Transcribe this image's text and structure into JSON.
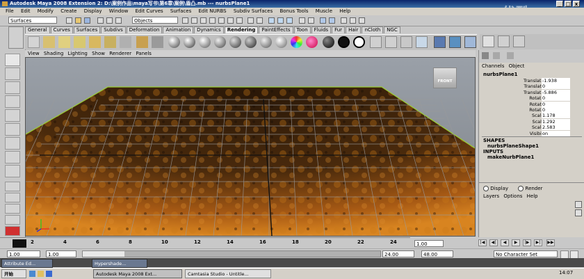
{
  "window": {
    "title": "Autodesk Maya 2008 Extension 2: D:\\案例作品\\maya写书\\第6章\\案例\\盾凸.mb  ---  nurbsPlane1",
    "min": "_",
    "max": "□",
    "close": "x"
  },
  "watermark": "优酷",
  "menu": [
    "File",
    "Edit",
    "Modify",
    "Create",
    "Display",
    "Window",
    "Edit Curves",
    "Surfaces",
    "Edit NURBS",
    "Subdiv Surfaces",
    "Bonus Tools",
    "Muscle",
    "Help"
  ],
  "status_line": {
    "menu_set": "Surfaces",
    "selection_mode": "Objects"
  },
  "shelf_tabs": [
    "General",
    "Curves",
    "Surfaces",
    "Subdivs",
    "Deformation",
    "Animation",
    "Dynamics",
    "Rendering",
    "PaintEffects",
    "Toon",
    "Fluids",
    "Fur",
    "Hair",
    "nCloth",
    "NGC"
  ],
  "active_shelf_tab": "Rendering",
  "panel_menu": [
    "View",
    "Shading",
    "Lighting",
    "Show",
    "Renderer",
    "Panels"
  ],
  "view_cube": "FRONT",
  "channel_box": {
    "tabs": [
      "Channels",
      "Object"
    ],
    "object_name": "nurbsPlane1",
    "attributes": [
      {
        "name": "Translate X",
        "value": "-1.938"
      },
      {
        "name": "Translate Y",
        "value": "0"
      },
      {
        "name": "Translate Z",
        "value": "-5.886"
      },
      {
        "name": "Rotate X",
        "value": "0"
      },
      {
        "name": "Rotate Y",
        "value": "0"
      },
      {
        "name": "Rotate Z",
        "value": "0"
      },
      {
        "name": "Scale X",
        "value": "1.178"
      },
      {
        "name": "Scale Y",
        "value": "1.292"
      },
      {
        "name": "Scale Z",
        "value": "2.583"
      },
      {
        "name": "Visibility",
        "value": "on"
      }
    ],
    "shapes_heading": "SHAPES",
    "shape_name": "nurbsPlaneShape1",
    "inputs_heading": "INPUTS",
    "input_name": "makeNurbPlane1"
  },
  "layer_editor": {
    "display_label": "Display",
    "render_label": "Render",
    "menu": [
      "Layers",
      "Options",
      "Help"
    ]
  },
  "time_slider": {
    "ticks": [
      "2",
      "4",
      "6",
      "8",
      "10",
      "12",
      "14",
      "16",
      "18",
      "20",
      "22",
      "24"
    ],
    "current_frame": "1.00"
  },
  "range_slider": {
    "start": "1.00",
    "start_inner": "1.00",
    "end_inner": "24.00",
    "end": "48.00",
    "character_set": "No Character Set"
  },
  "taskbar": {
    "start": "开始",
    "tasks": [
      "Autodesk Maya 2008 Ext...",
      "Camtasia Studio - Untitle..."
    ],
    "top_tasks": [
      "Attribute Ed...",
      "Hypershade..."
    ],
    "clock": "14:07"
  },
  "colors": {
    "title_bar": "#0a246a",
    "viewport_bg": "#8a8f96",
    "surface_orange": "#c87818",
    "surface_dark": "#2a1808",
    "grid": "#9a9a9a",
    "surface_edge": "#9acd32"
  }
}
